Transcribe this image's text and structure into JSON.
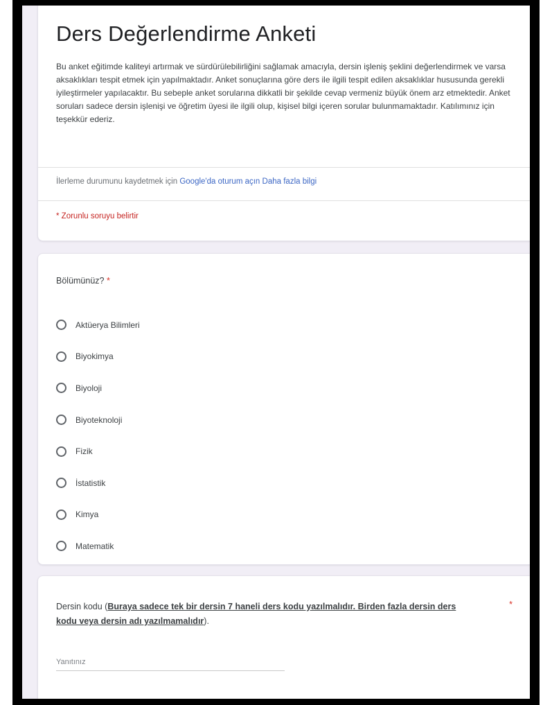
{
  "form": {
    "title": "Ders Değerlendirme Anketi",
    "description": "Bu anket eğitimde kaliteyi artırmak ve sürdürülebilirliğini sağlamak amacıyla, dersin işleniş şeklini değerlendirmek ve varsa aksaklıkları tespit etmek için yapılmaktadır. Anket sonuçlarına göre ders ile ilgili tespit edilen aksaklıklar hususunda gerekli iyileştirmeler yapılacaktır. Bu sebeple anket sorularına dikkatli bir şekilde cevap vermeniz büyük önem arz etmektedir. Anket soruları sadece dersin işlenişi ve öğretim üyesi ile ilgili olup, kişisel bilgi içeren sorular bulunmamaktadır. Katılımınız için teşekkür ederiz.",
    "signin_text": "İlerleme durumunu kaydetmek için ",
    "signin_link": "Google'da oturum açın",
    "more_info_link": "Daha fazla bilgi",
    "required_note": "* Zorunlu soruyu belirtir"
  },
  "question1": {
    "label": "Bölümünüz?",
    "required_mark": "*",
    "options": [
      "Aktüerya Bilimleri",
      "Biyokimya",
      "Biyoloji",
      "Biyoteknoloji",
      "Fizik",
      "İstatistik",
      "Kimya",
      "Matematik"
    ]
  },
  "question2": {
    "label_start": "Dersin kodu (",
    "label_emphasis": "Buraya sadece  tek bir dersin 7 haneli  ders kodu yazılmalıdır. Birden fazla dersin ders kodu veya dersin adı yazılmamalıdır",
    "label_end": ").",
    "required_mark": "*",
    "placeholder": "Yanıtınız"
  }
}
